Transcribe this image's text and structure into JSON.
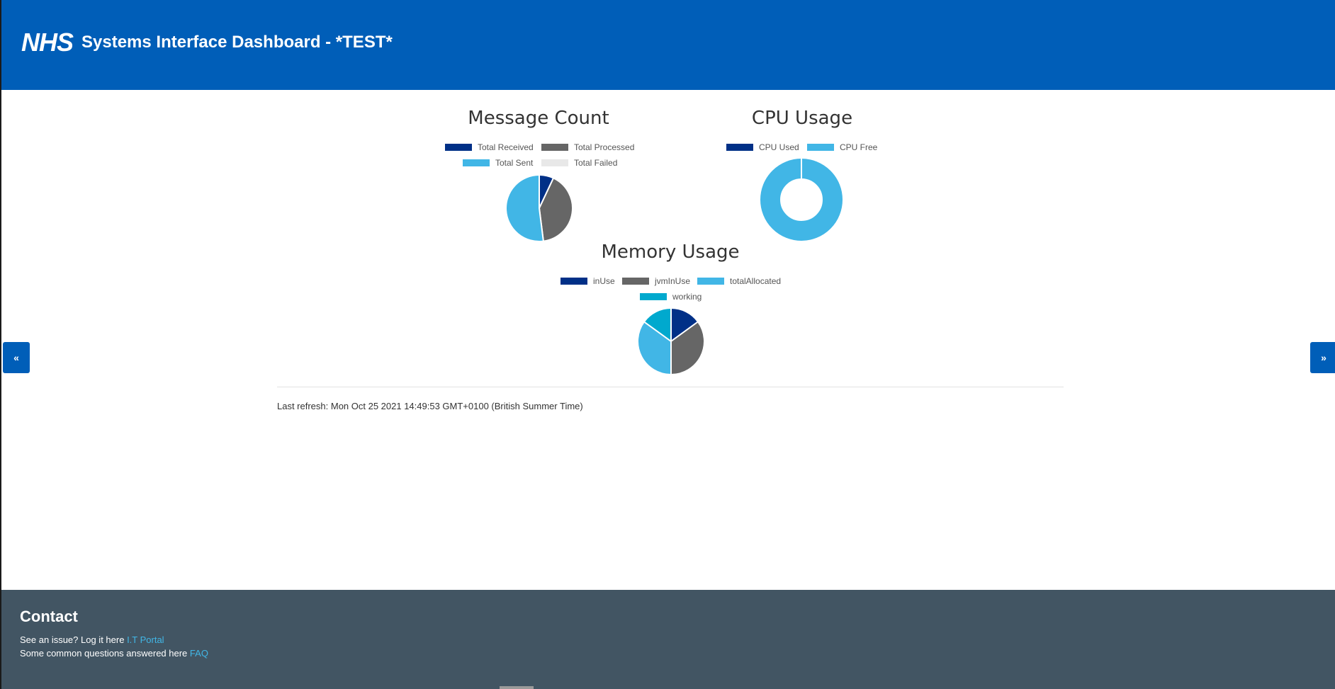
{
  "header": {
    "logo": "NHS",
    "title": "Systems Interface Dashboard - *TEST*"
  },
  "charts": [
    {
      "title": "Message Count",
      "legend": [
        "Total Received",
        "Total Processed",
        "Total Sent",
        "Total Failed"
      ],
      "colors": [
        "#003087",
        "#666666",
        "#41b6e6",
        "#e8e8e8"
      ]
    },
    {
      "title": "CPU Usage",
      "legend": [
        "CPU Used",
        "CPU Free"
      ],
      "colors": [
        "#003087",
        "#41b6e6"
      ]
    },
    {
      "title": "Memory Usage",
      "legend": [
        "inUse",
        "jvmInUse",
        "totalAllocated",
        "working"
      ],
      "colors": [
        "#003087",
        "#666666",
        "#41b6e6",
        "#00a9ce"
      ]
    }
  ],
  "chart_data": [
    {
      "type": "pie",
      "title": "Message Count",
      "categories": [
        "Total Received",
        "Total Processed",
        "Total Sent",
        "Total Failed"
      ],
      "values": [
        7,
        41,
        52,
        0
      ]
    },
    {
      "type": "pie",
      "variant": "doughnut",
      "title": "CPU Usage",
      "categories": [
        "CPU Used",
        "CPU Free"
      ],
      "values": [
        0,
        100
      ]
    },
    {
      "type": "pie",
      "title": "Memory Usage",
      "categories": [
        "inUse",
        "jvmInUse",
        "totalAllocated",
        "working"
      ],
      "values": [
        15,
        35,
        35,
        15
      ]
    }
  ],
  "refresh": {
    "text": "Last refresh: Mon Oct 25 2021 14:49:53 GMT+0100 (British Summer Time)"
  },
  "nav": {
    "prev": "«",
    "next": "»"
  },
  "footer": {
    "heading": "Contact",
    "issue_text": "See an issue? Log it here",
    "issue_link": "I.T Portal",
    "faq_text": "Some common questions answered here",
    "faq_link": "FAQ"
  }
}
